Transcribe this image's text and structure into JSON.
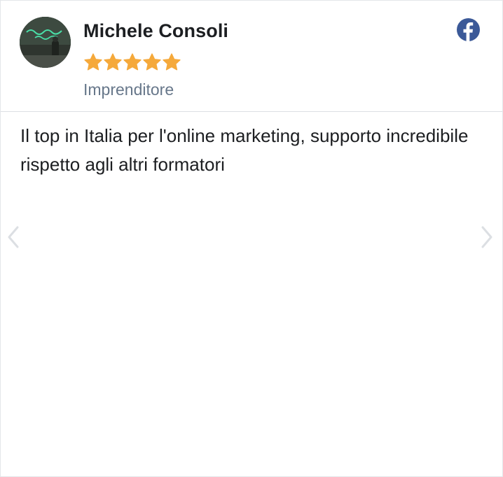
{
  "review": {
    "author_name": "Michele Consoli",
    "author_role": "Imprenditore",
    "rating": 5,
    "rating_max": 5,
    "text": "Il top in Italia per l'online marketing, supporto incredibile rispetto agli altri formatori",
    "source_icon": "facebook-icon"
  },
  "colors": {
    "star": "#f5a93b",
    "facebook_blue": "#3b5998",
    "name_text": "#1c1e21",
    "role_text": "#67778a",
    "arrow": "#dcdfe3"
  },
  "navigation": {
    "prev_icon": "chevron-left-icon",
    "next_icon": "chevron-right-icon"
  }
}
